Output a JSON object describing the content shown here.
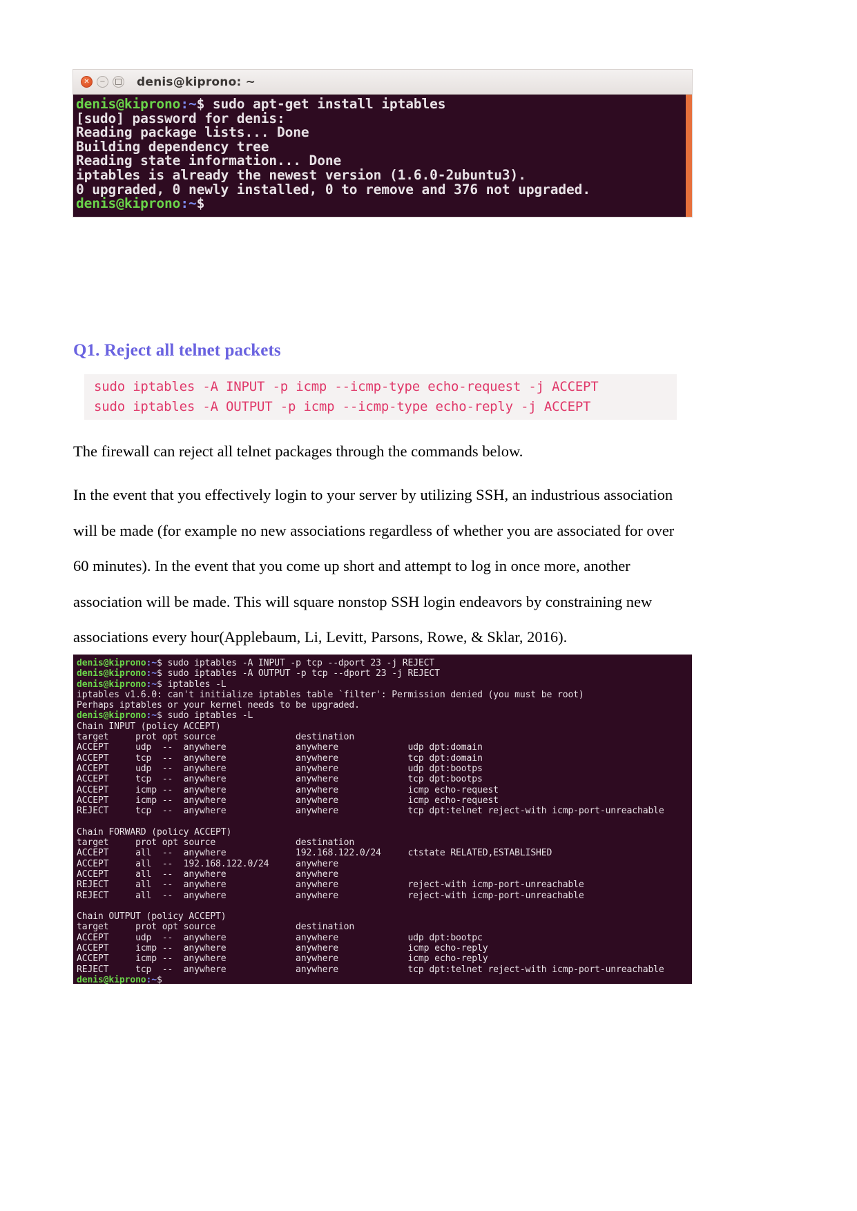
{
  "document": {
    "heading_q1": "Q1. Reject all telnet packets",
    "paragraph_lead": "The firewall can reject all telnet packages through the commands below.",
    "paragraph_body": "In the event that you effectively login to your server by utilizing SSH, an industrious association will be made (for example no new associations regardless of whether you are associated for over 60 minutes). In the event that you come up short and attempt to log in once more, another association will be made. This will square nonstop SSH login endeavors by constraining new associations every hour(Applebaum, Li, Levitt, Parsons, Rowe, & Sklar, 2016).",
    "code_block": "sudo iptables -A INPUT -p icmp --icmp-type echo-request -j ACCEPT\nsudo iptables -A OUTPUT -p icmp --icmp-type echo-reply -j ACCEPT"
  },
  "terminal_top": {
    "title": "denis@kiprono: ~",
    "window_buttons": [
      "close-icon",
      "minimize-icon",
      "maximize-icon"
    ],
    "prompt_user_host": "denis@kiprono",
    "prompt_path": ":~",
    "prompt_symbol": "$ ",
    "command": "sudo apt-get install iptables",
    "output_lines": [
      "[sudo] password for denis:",
      "Reading package lists... Done",
      "Building dependency tree",
      "Reading state information... Done",
      "iptables is already the newest version (1.6.0-2ubuntu3).",
      "0 upgraded, 0 newly installed, 0 to remove and 376 not upgraded."
    ],
    "trailing_prompt_user_host": "denis@kiprono",
    "trailing_prompt_path": ":~",
    "trailing_prompt_symbol": "$"
  },
  "terminal_bottom": {
    "prompt": "denis@kiprono",
    "path": ":~",
    "dollar": "$ ",
    "lines": [
      {
        "type": "cmd",
        "text": "sudo iptables -A INPUT -p tcp --dport 23 -j REJECT"
      },
      {
        "type": "cmd",
        "text": "sudo iptables -A OUTPUT -p tcp --dport 23 -j REJECT"
      },
      {
        "type": "cmd",
        "text": "iptables -L"
      },
      {
        "type": "out",
        "text": "iptables v1.6.0: can't initialize iptables table `filter': Permission denied (you must be root)"
      },
      {
        "type": "out",
        "text": "Perhaps iptables or your kernel needs to be upgraded."
      },
      {
        "type": "cmd",
        "text": "sudo iptables -L"
      },
      {
        "type": "out",
        "text": "Chain INPUT (policy ACCEPT)"
      },
      {
        "type": "out",
        "text": "target     prot opt source               destination         "
      },
      {
        "type": "out",
        "text": "ACCEPT     udp  --  anywhere             anywhere             udp dpt:domain"
      },
      {
        "type": "out",
        "text": "ACCEPT     tcp  --  anywhere             anywhere             tcp dpt:domain"
      },
      {
        "type": "out",
        "text": "ACCEPT     udp  --  anywhere             anywhere             udp dpt:bootps"
      },
      {
        "type": "out",
        "text": "ACCEPT     tcp  --  anywhere             anywhere             tcp dpt:bootps"
      },
      {
        "type": "out",
        "text": "ACCEPT     icmp --  anywhere             anywhere             icmp echo-request"
      },
      {
        "type": "out",
        "text": "ACCEPT     icmp --  anywhere             anywhere             icmp echo-request"
      },
      {
        "type": "out",
        "text": "REJECT     tcp  --  anywhere             anywhere             tcp dpt:telnet reject-with icmp-port-unreachable"
      },
      {
        "type": "out",
        "text": ""
      },
      {
        "type": "out",
        "text": "Chain FORWARD (policy ACCEPT)"
      },
      {
        "type": "out",
        "text": "target     prot opt source               destination         "
      },
      {
        "type": "out",
        "text": "ACCEPT     all  --  anywhere             192.168.122.0/24     ctstate RELATED,ESTABLISHED"
      },
      {
        "type": "out",
        "text": "ACCEPT     all  --  192.168.122.0/24     anywhere            "
      },
      {
        "type": "out",
        "text": "ACCEPT     all  --  anywhere             anywhere            "
      },
      {
        "type": "out",
        "text": "REJECT     all  --  anywhere             anywhere             reject-with icmp-port-unreachable"
      },
      {
        "type": "out",
        "text": "REJECT     all  --  anywhere             anywhere             reject-with icmp-port-unreachable"
      },
      {
        "type": "out",
        "text": ""
      },
      {
        "type": "out",
        "text": "Chain OUTPUT (policy ACCEPT)"
      },
      {
        "type": "out",
        "text": "target     prot opt source               destination         "
      },
      {
        "type": "out",
        "text": "ACCEPT     udp  --  anywhere             anywhere             udp dpt:bootpc"
      },
      {
        "type": "out",
        "text": "ACCEPT     icmp --  anywhere             anywhere             icmp echo-reply"
      },
      {
        "type": "out",
        "text": "ACCEPT     icmp --  anywhere             anywhere             icmp echo-reply"
      },
      {
        "type": "out",
        "text": "REJECT     tcp  --  anywhere             anywhere             tcp dpt:telnet reject-with icmp-port-unreachable"
      },
      {
        "type": "prompt-only",
        "text": ""
      }
    ]
  },
  "colors": {
    "terminal_bg": "#2e0b21",
    "prompt_green": "#6ad44a",
    "prompt_blue": "#7d8cf0",
    "heading_purple": "#6a63e0",
    "code_pink": "#e0396a",
    "code_bg": "#f5f2f2",
    "scrollbar_orange": "#e6703c"
  }
}
